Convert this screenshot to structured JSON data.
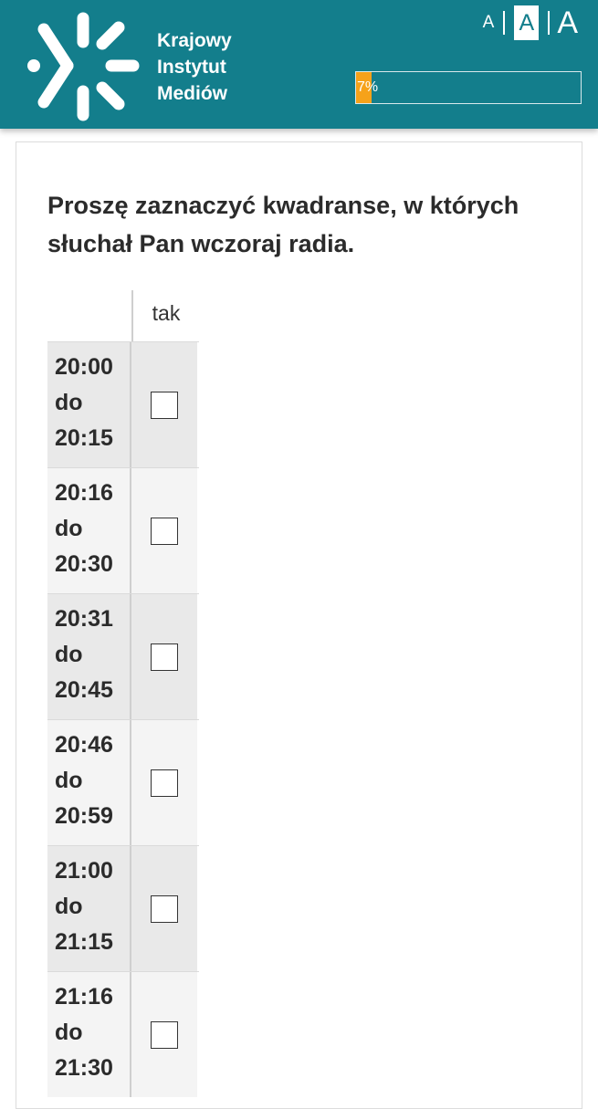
{
  "header": {
    "logo_icon": "kim-logo-icon",
    "logo_lines": [
      "Krajowy",
      "Instytut",
      "Mediów"
    ],
    "font_size_options": [
      "A",
      "A",
      "A"
    ],
    "progress_percent": 7,
    "progress_label": "7%",
    "colors": {
      "brand": "#137e8c",
      "progress": "#f6a21a"
    }
  },
  "question": {
    "text": "Proszę zaznaczyć kwadranse, w których słuchał Pan wczoraj radia."
  },
  "grid": {
    "column_header": "tak",
    "rows": [
      {
        "from": "20:00",
        "sep": "do",
        "to": "20:15",
        "checked": false
      },
      {
        "from": "20:16",
        "sep": "do",
        "to": "20:30",
        "checked": false
      },
      {
        "from": "20:31",
        "sep": "do",
        "to": "20:45",
        "checked": false
      },
      {
        "from": "20:46",
        "sep": "do",
        "to": "20:59",
        "checked": false
      },
      {
        "from": "21:00",
        "sep": "do",
        "to": "21:15",
        "checked": false
      },
      {
        "from": "21:16",
        "sep": "do",
        "to": "21:30",
        "checked": false
      }
    ]
  }
}
